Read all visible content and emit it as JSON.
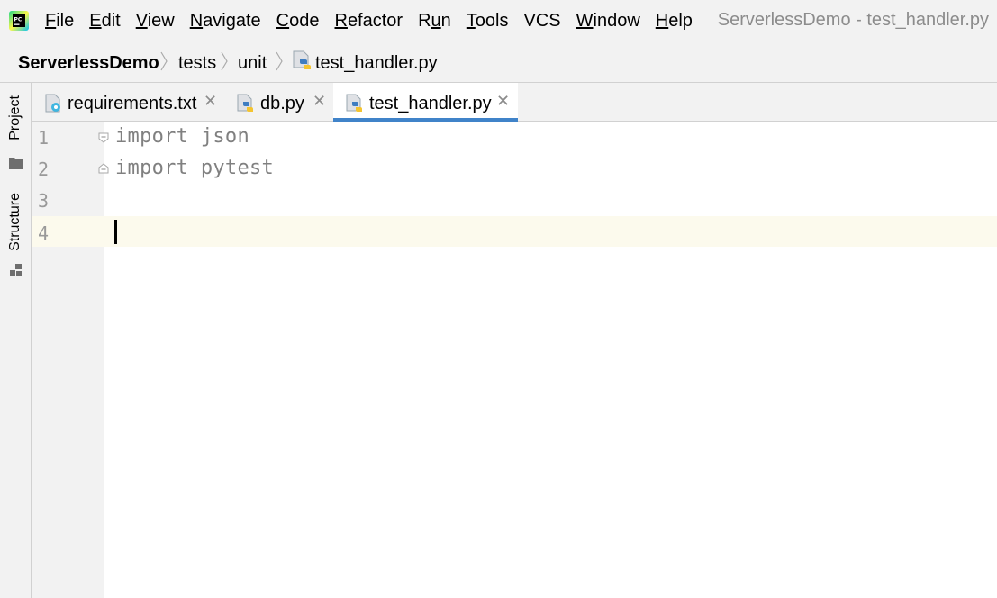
{
  "menubar": {
    "items": [
      "File",
      "Edit",
      "View",
      "Navigate",
      "Code",
      "Refactor",
      "Run",
      "Tools",
      "VCS",
      "Window",
      "Help"
    ],
    "mnemonics": [
      "F",
      "E",
      "V",
      "N",
      "C",
      "R",
      "u",
      "T",
      "",
      "W",
      "H"
    ],
    "window_title": "ServerlessDemo - test_handler.py"
  },
  "breadcrumb": {
    "project": "ServerlessDemo",
    "folder1": "tests",
    "folder2": "unit",
    "file": "test_handler.py"
  },
  "toolstrip": {
    "project_label": "Project",
    "structure_label": "Structure"
  },
  "tabs": [
    {
      "label": "requirements.txt",
      "icon": "text-file-icon",
      "active": false
    },
    {
      "label": "db.py",
      "icon": "python-file-icon",
      "active": false
    },
    {
      "label": "test_handler.py",
      "icon": "python-file-icon",
      "active": true
    }
  ],
  "editor": {
    "line_numbers": [
      "1",
      "2",
      "3",
      "4"
    ],
    "lines": [
      "import json",
      "import pytest",
      "",
      ""
    ],
    "caret_line": 4
  },
  "colors": {
    "accent": "#4083c9",
    "caret_row": "#fcfaed",
    "code_text": "#808080"
  }
}
